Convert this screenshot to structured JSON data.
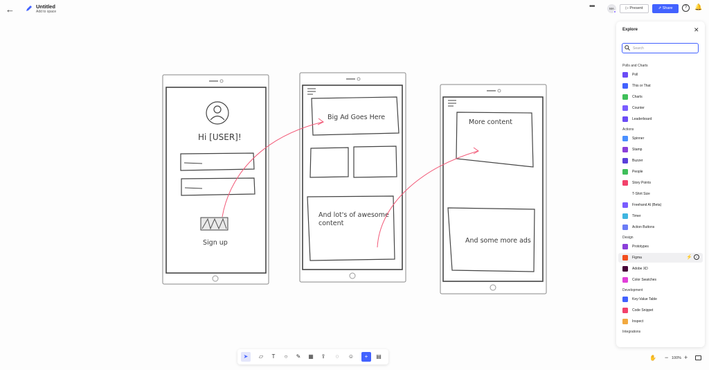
{
  "header": {
    "back_icon": "arrow-left-icon",
    "doc_icon": "pencil-icon",
    "title": "Untitled",
    "subtitle": "Add to space",
    "more_icon": "more-icon",
    "avatar_initials": "MA",
    "present_label": "Present",
    "share_label": "Share",
    "help_icon": "help-icon",
    "bell_icon": "bell-icon",
    "accent_color": "#4262ff"
  },
  "canvas": {
    "screen1": {
      "greeting": "Hi  [USER]!",
      "signup": "Sign up"
    },
    "screen2": {
      "ad": "Big Ad Goes Here",
      "content_line1": "And lot's of awesome",
      "content_line2": "content"
    },
    "screen3": {
      "more": "More content",
      "ads": "And some more ads"
    },
    "connector_color": "#f25a78"
  },
  "explore": {
    "title": "Explore",
    "close_icon": "close-icon",
    "search_placeholder": "Search",
    "sections": [
      {
        "title": "Polls and Charts",
        "items": [
          {
            "label": "Poll",
            "icon": "poll-icon",
            "color": "#6b4cf6"
          },
          {
            "label": "This or That",
            "icon": "this-or-that-icon",
            "color": "#4262ff"
          },
          {
            "label": "Charts",
            "icon": "charts-icon",
            "color": "#3fbf5a"
          },
          {
            "label": "Counter",
            "icon": "counter-icon",
            "color": "#7a5cff"
          },
          {
            "label": "Leaderboard",
            "icon": "leaderboard-icon",
            "color": "#6b4cf6"
          }
        ]
      },
      {
        "title": "Actions",
        "items": [
          {
            "label": "Spinner",
            "icon": "spinner-icon",
            "color": "#4a90ff"
          },
          {
            "label": "Stamp",
            "icon": "stamp-icon",
            "color": "#8b3fd9"
          },
          {
            "label": "Buzzer",
            "icon": "buzzer-icon",
            "color": "#5a3fd9"
          },
          {
            "label": "People",
            "icon": "people-icon",
            "color": "#3fbf5a"
          },
          {
            "label": "Story Points",
            "icon": "story-points-icon",
            "color": "#f2426b"
          },
          {
            "label": "T-Shirt Size",
            "icon": "tshirt-icon",
            "color": "#ffffff"
          },
          {
            "label": "Freehand AI (Beta)",
            "icon": "sparkle-icon",
            "color": "#7a5cff"
          },
          {
            "label": "Timer",
            "icon": "timer-icon",
            "color": "#3fb5e0"
          },
          {
            "label": "Action Buttons",
            "icon": "action-buttons-icon",
            "color": "#6b7cf6"
          }
        ]
      },
      {
        "title": "Design",
        "items": [
          {
            "label": "Prototypes",
            "icon": "prototypes-icon",
            "color": "#8b3fd9"
          },
          {
            "label": "Figma",
            "icon": "figma-icon",
            "color": "#f24e1e",
            "highlighted": true
          },
          {
            "label": "Adobe XD",
            "icon": "adobe-xd-icon",
            "color": "#470137"
          },
          {
            "label": "Color Swatches",
            "icon": "color-swatches-icon",
            "color": "#e23fd9"
          }
        ]
      },
      {
        "title": "Development",
        "items": [
          {
            "label": "Key-Value Table",
            "icon": "table-icon",
            "color": "#4262ff"
          },
          {
            "label": "Code Snippet",
            "icon": "code-snippet-icon",
            "color": "#f2426b"
          },
          {
            "label": "Inspect",
            "icon": "inspect-icon",
            "color": "#f2a93f"
          }
        ]
      },
      {
        "title": "Integrations",
        "items": []
      }
    ],
    "bolt_icon": "bolt-icon",
    "download_icon": "download-icon"
  },
  "toolbar": {
    "tools": [
      {
        "name": "select-tool",
        "glyph": "➤",
        "active": true
      },
      {
        "name": "sticky-note-tool",
        "glyph": "▱"
      },
      {
        "name": "text-tool",
        "glyph": "T"
      },
      {
        "name": "shape-tool",
        "glyph": "○"
      },
      {
        "name": "pen-tool",
        "glyph": "✎"
      },
      {
        "name": "table-tool",
        "glyph": "▦"
      },
      {
        "name": "upload-tool",
        "glyph": "⇪"
      },
      {
        "name": "comment-tool",
        "glyph": "◌"
      },
      {
        "name": "emoji-tool",
        "glyph": "☺"
      },
      {
        "name": "add-tool",
        "glyph": "+",
        "primary": true
      },
      {
        "name": "template-tool",
        "glyph": "▤"
      }
    ]
  },
  "zoom": {
    "level": "100%",
    "minus": "−",
    "plus": "+"
  }
}
